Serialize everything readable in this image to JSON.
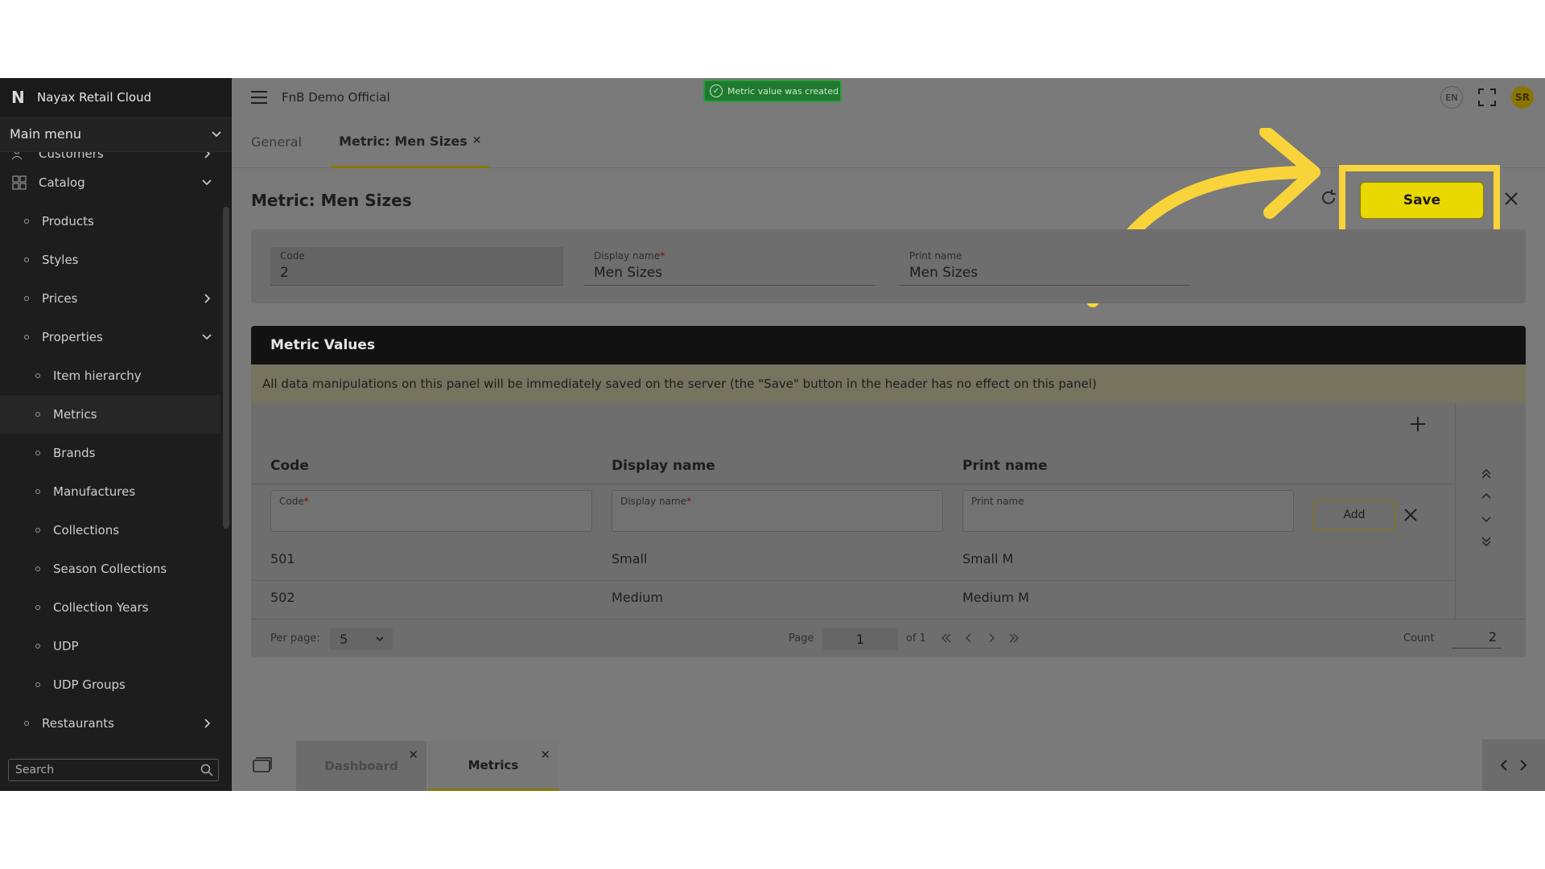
{
  "sidebar": {
    "brand": "Nayax Retail Cloud",
    "main_menu_label": "Main menu",
    "search_placeholder": "Search",
    "items": [
      {
        "label": "Customers"
      },
      {
        "label": "Catalog"
      },
      {
        "label": "Products"
      },
      {
        "label": "Styles"
      },
      {
        "label": "Prices"
      },
      {
        "label": "Properties"
      },
      {
        "label": "Item hierarchy"
      },
      {
        "label": "Metrics"
      },
      {
        "label": "Brands"
      },
      {
        "label": "Manufactures"
      },
      {
        "label": "Collections"
      },
      {
        "label": "Season Collections"
      },
      {
        "label": "Collection Years"
      },
      {
        "label": "UDP"
      },
      {
        "label": "UDP Groups"
      },
      {
        "label": "Restaurants"
      }
    ]
  },
  "topbar": {
    "org_name": "FnB Demo Official",
    "toast": "Metric value was created",
    "lang": "EN",
    "avatar": "SR"
  },
  "tabs": [
    {
      "label": "General"
    },
    {
      "label": "Metric: Men Sizes"
    }
  ],
  "page": {
    "title": "Metric: Men Sizes",
    "save_label": "Save"
  },
  "form": {
    "code": {
      "label": "Code",
      "value": "2"
    },
    "display_name": {
      "label": "Display name",
      "value": "Men Sizes"
    },
    "print_name": {
      "label": "Print name",
      "value": "Men Sizes"
    }
  },
  "metric_values": {
    "title": "Metric Values",
    "note": "All data manipulations on this panel will be immediately saved on the server (the \"Save\" button in the header has no effect on this panel)",
    "columns": [
      "Code",
      "Display name",
      "Print name"
    ],
    "new_row": {
      "code_label": "Code",
      "display_label": "Display name",
      "print_label": "Print name",
      "add_label": "Add"
    },
    "rows": [
      {
        "code": "501",
        "display": "Small",
        "print": "Small M"
      },
      {
        "code": "502",
        "display": "Medium",
        "print": "Medium M"
      }
    ]
  },
  "pager": {
    "per_page_label": "Per page:",
    "per_page_value": "5",
    "page_label": "Page",
    "page_value": "1",
    "of_label": "of 1",
    "count_label": "Count",
    "count_value": "2"
  },
  "bottom_tabs": [
    {
      "label": "Dashboard"
    },
    {
      "label": "Metrics"
    }
  ],
  "colors": {
    "accent": "#e9d800",
    "highlight": "#f8d43a",
    "toast_bg": "#1f7a2f"
  }
}
